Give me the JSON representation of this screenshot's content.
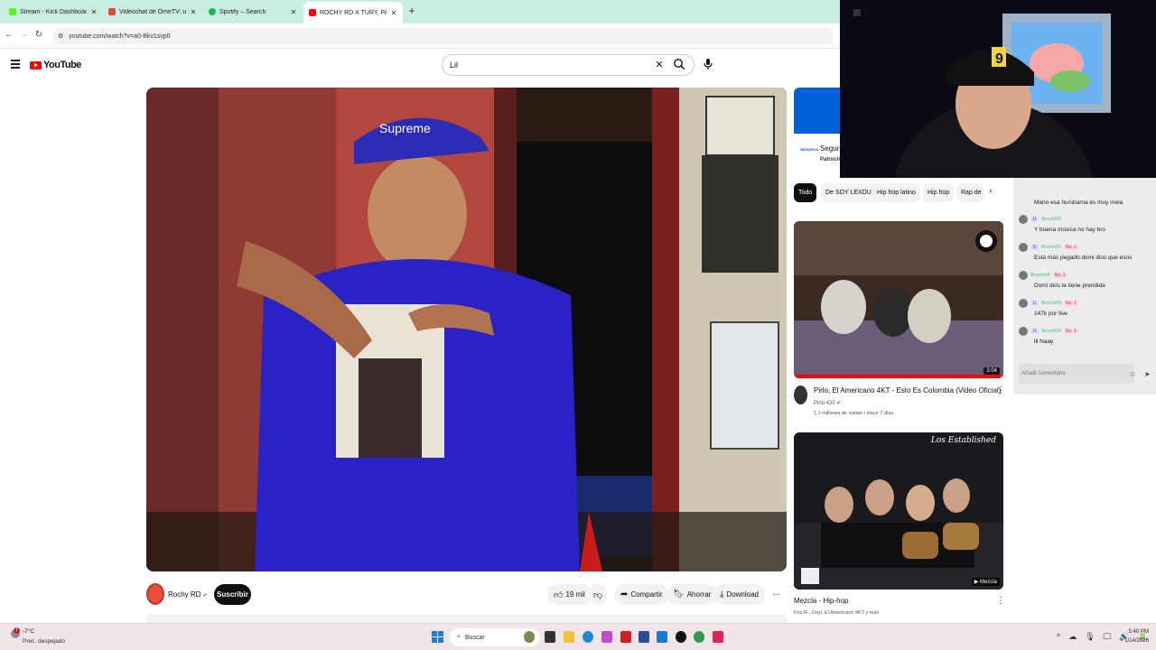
{
  "browser": {
    "tabs": [
      {
        "title": "Stream - Kick Dashboard",
        "color": "#53fc18"
      },
      {
        "title": "Videochat de OmeTV: una",
        "color": "#e14646"
      },
      {
        "title": "Spotify – Search",
        "color": "#1db954"
      },
      {
        "title": "ROCHY RD X TURY, PAPO E",
        "color": "#ff0000"
      }
    ],
    "new_tab_icon": "+",
    "url": "youtube.com/watch?v=a0-Bkv1svp0",
    "back_icon": "←",
    "forward_icon": "→",
    "reload_icon": "↻"
  },
  "youtube": {
    "logo_text": "YouTube",
    "search_value": "Lil",
    "clear_icon": "✕",
    "video": {
      "channel_name": "Rochy RD",
      "verified_icon": "✔",
      "subscribe_label": "Suscribir",
      "like_count": "19 mil",
      "share_label": "Compartir",
      "save_label": "Ahorrar",
      "download_label": "Download",
      "more_icon": "⋯"
    },
    "ad": {
      "title": "Seguro",
      "subtitle": "Patrocin",
      "logo_text": "SEGUROS"
    },
    "chips": [
      "Todo",
      "De SOY LEXDU",
      "Hip hop latino",
      "Hip hop",
      "Rap de"
    ],
    "chip_next_icon": "›",
    "recommendations": [
      {
        "title": "Pirlo, El Americano 4KT - Esto Es Colombia (Video Oficial)",
        "channel": "Pirlo 420",
        "meta": "1,1 millones de visitas • Hace 7 días",
        "duration": "3:04"
      },
      {
        "title": "Mezcla - Hip-hop",
        "channel": "Kris R., Onyl, El Americano 4KT y más",
        "meta": "",
        "duration": "Mezcla",
        "thumb_logo": "Los Established"
      }
    ]
  },
  "chat": {
    "messages": [
      {
        "user": "",
        "badges": [],
        "text": "Mano esa hursbarna es muy mela"
      },
      {
        "user": "Brochi09",
        "badges": [
          "11"
        ],
        "text": "Y buena música no hay bro"
      },
      {
        "user": "Brochi09",
        "badges": [
          "11",
          "No. 1"
        ],
        "text": "Está más pegado domi dios que esos"
      },
      {
        "user": "Brochi09",
        "badges": [
          "No. 1"
        ],
        "text": "Domi dios la tiene prendida"
      },
      {
        "user": "Brochi09",
        "badges": [
          "11",
          "No. 1"
        ],
        "text": "147k por live"
      },
      {
        "user": "Brochi09",
        "badges": [
          "11",
          "No. 1"
        ],
        "text": "lll Naay"
      }
    ],
    "input_placeholder": "Añadir comentario"
  },
  "taskbar": {
    "weather_temp": "-7°C",
    "weather_cond": "Prec. despejado",
    "weather_badge": "1",
    "search_label": "Buscar",
    "clock_time": "5:40 PM",
    "clock_date": "1/14/2026",
    "tray_icons": [
      "^",
      "☁",
      "🎙",
      "🖵",
      "🔊",
      "🔋"
    ]
  }
}
